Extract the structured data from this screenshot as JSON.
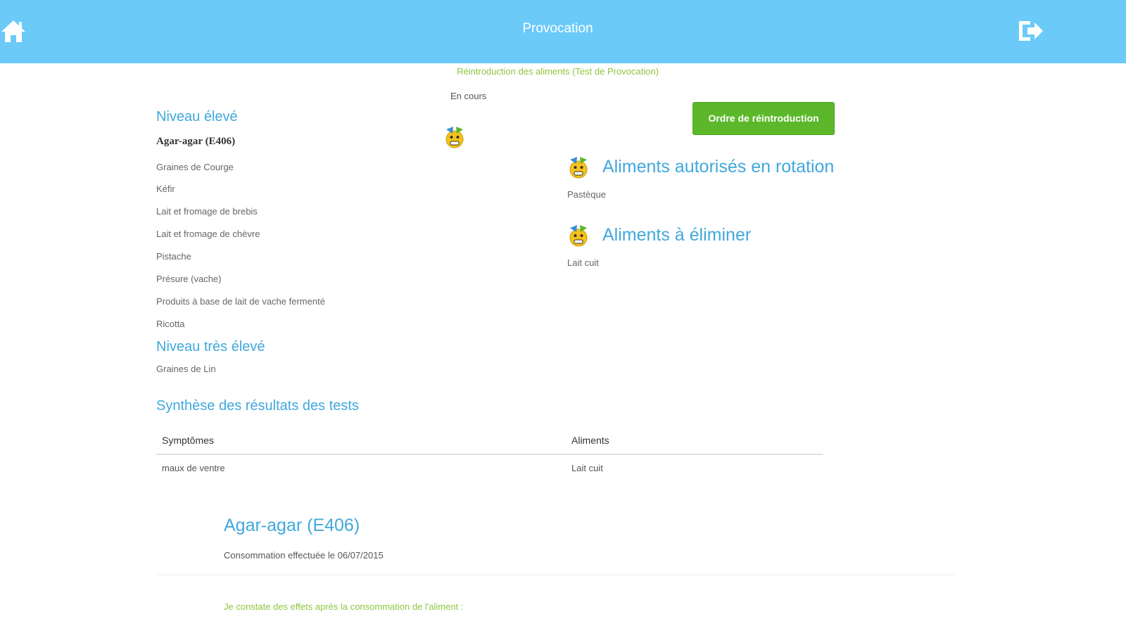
{
  "header": {
    "title": "Provocation",
    "home_icon": "home-icon",
    "logout_icon": "logout-icon",
    "background_color": "#6bcaf8"
  },
  "subtitle": "Réintroduction des aliments (Test de Provocation)",
  "status": "En cours",
  "order_button_label": "Ordre de réintroduction",
  "levels": {
    "high": {
      "title": "Niveau élevé",
      "current_food": "Agar-agar (E406)",
      "foods": [
        "Graines de Courge",
        "Kéfir",
        "Lait et fromage de brebis",
        "Lait et fromage de chèvre",
        "Pistache",
        "Présure (vache)",
        "Produits à base de lait de vache fermenté",
        "Ricotta"
      ]
    },
    "very_high": {
      "title": "Niveau très élevé",
      "foods": [
        "Graines de Lin"
      ]
    }
  },
  "allowed": {
    "title": "Aliments autorisés en rotation",
    "items": [
      "Pastèque"
    ]
  },
  "eliminate": {
    "title": "Aliments à éliminer",
    "items": [
      "Lait cuit"
    ]
  },
  "synthesis": {
    "title": "Synthèse des résultats des tests",
    "columns": [
      "Symptômes",
      "Aliments"
    ],
    "rows": [
      [
        "maux de ventre",
        "Lait cuit"
      ]
    ]
  },
  "detail": {
    "title": "Agar-agar (E406)",
    "date_text": "Consommation effectuée le 06/07/2015",
    "effects_text": "Je constate des effets après la consommation de l'aliment :"
  },
  "colors": {
    "accent_blue": "#41a8dc",
    "accent_green": "#5cb82a",
    "subtitle_green": "#8dc63f"
  }
}
